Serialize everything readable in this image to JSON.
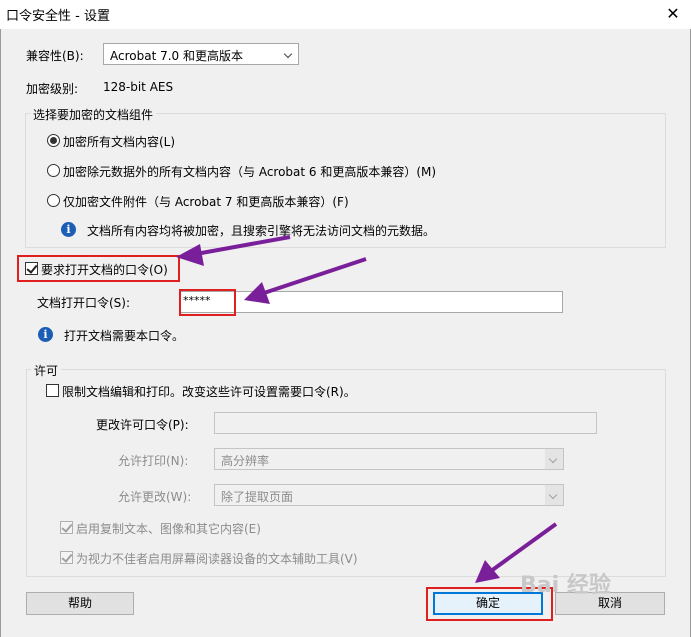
{
  "window": {
    "title": "口令安全性 - 设置",
    "close_glyph": "✕"
  },
  "compat": {
    "label": "兼容性(B):",
    "value": "Acrobat 7.0 和更高版本"
  },
  "encrypt_level": {
    "label": "加密级别:",
    "value": "128-bit AES"
  },
  "components": {
    "title": "选择要加密的文档组件",
    "options": [
      {
        "label": "加密所有文档内容(L)",
        "checked": true
      },
      {
        "label": "加密除元数据外的所有文档内容（与 Acrobat 6 和更高版本兼容）(M)",
        "checked": false
      },
      {
        "label": "仅加密文件附件（与 Acrobat 7 和更高版本兼容）(F)",
        "checked": false
      }
    ],
    "info": "文档所有内容均将被加密，且搜索引擎将无法访问文档的元数据。"
  },
  "open_password": {
    "checkbox_label": "要求打开文档的口令(O)",
    "checked": true,
    "field_label": "文档打开口令(S):",
    "field_value": "*****",
    "info": "打开文档需要本口令。"
  },
  "permissions": {
    "title": "许可",
    "restrict_label": "限制文档编辑和打印。改变这些许可设置需要口令(R)。",
    "change_pw_label": "更改许可口令(P):",
    "print_label": "允许打印(N):",
    "print_value": "高分辨率",
    "change_label": "允许更改(W):",
    "change_value": "除了提取页面",
    "copy_label": "启用复制文本、图像和其它内容(E)",
    "access_label": "为视力不佳者启用屏幕阅读器设备的文本辅助工具(V)"
  },
  "buttons": {
    "help": "帮助",
    "ok": "确定",
    "cancel": "取消"
  },
  "watermark": "Bai 经验",
  "colors": {
    "annotation_red": "#e02020",
    "annotation_purple": "#7a1f9a",
    "info_blue": "#1c5db5",
    "focus_blue": "#0078d7"
  }
}
